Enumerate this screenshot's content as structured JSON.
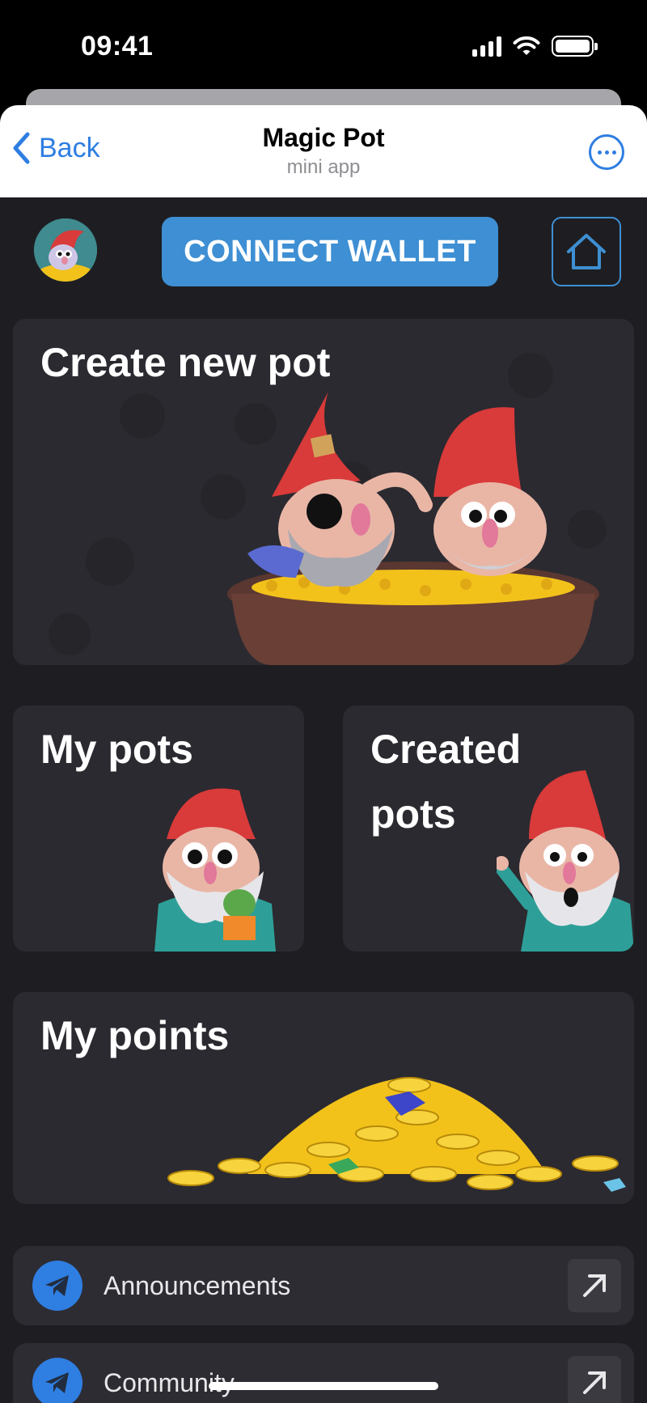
{
  "status_bar": {
    "time": "09:41"
  },
  "header": {
    "back_label": "Back",
    "title": "Magic Pot",
    "subtitle": "mini app"
  },
  "topbar": {
    "connect_wallet_label": "CONNECT WALLET"
  },
  "cards": {
    "create": {
      "title": "Create new pot"
    },
    "my_pots": {
      "title": "My pots"
    },
    "created_pots": {
      "title_line1": "Created",
      "title_line2": "pots"
    },
    "my_points": {
      "title": "My points"
    }
  },
  "links": [
    {
      "label": "Announcements"
    },
    {
      "label": "Community"
    }
  ],
  "colors": {
    "accent": "#3e8fd3",
    "ios_blue": "#2f7ee2",
    "app_bg": "#1e1e22",
    "card_bg": "#2b2a30",
    "gnome_hat": "#d93a3a",
    "gold": "#f2c21b"
  }
}
